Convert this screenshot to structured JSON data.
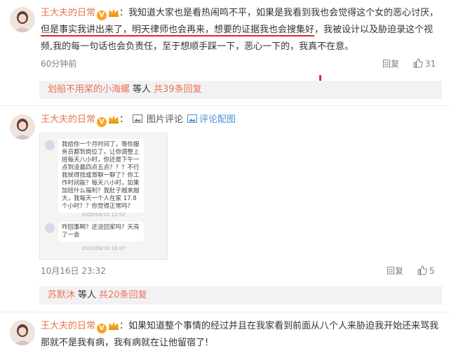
{
  "comments": [
    {
      "username": "王大夫的日常",
      "text_before": "：我知道大家也是看热闹鸣不平，如果是我看到我也会觉得这个女的恶心讨厌，",
      "text_underlined": "但是事实我讲出来了，明天律师也会再来，想要的证据我也会搜集好",
      "text_after": "，我被设计以及胁迫录这个视频,我的每一句话也会负责任，至于想顺手踩一下，恶心一下的，我真不在意。",
      "time": "60分钟前",
      "reply_label": "回复",
      "likes": "31",
      "replies": {
        "who": "划船不用桨的小海螺",
        "etc": "等人",
        "total": "共39条回复"
      }
    },
    {
      "username": "王大夫的日常",
      "text_before": "：",
      "pic_label": "图片评论",
      "pic_link": "评论配图",
      "time": "10月16日 23:32",
      "reply_label": "回复",
      "likes": "5",
      "replies": {
        "who": "苏默沐",
        "etc": "等人",
        "total": "共20条回复"
      },
      "chat_image": {
        "bubble1": "我给你一个月时间了，等你服务员都到岗位了，让你调整上班每天八小时，你还是下午一点到凌晨四点五点？？？不行我就得找或哥聊一聊了？你工作时间能？每天八小时，如果加班什么福利？我肚子越来越大，我每天一个人在家 17.8 个小时？？你觉得正常吗？",
        "time1": "2020/08/10 12:02",
        "bubble2": "咋回事啊？还没回家吗？天亮了一会",
        "time2": "2020/08/10 18:07"
      }
    },
    {
      "username": "王大夫的日常",
      "text": "：如果知道整个事情的经过并且在我家看到前面从八个人来胁迫我开始还来骂我那就不是我有病，我有病就在让他留宿了!"
    }
  ],
  "colors": {
    "accent": "#eb7350",
    "underline": "#e0262a",
    "link": "#4a8fd6",
    "reply_bg": "#f2f2f5"
  },
  "icons": {
    "like": "thumbs-up-icon",
    "vip": "vip-v-icon",
    "crown": "crown-icon",
    "picture": "picture-icon"
  }
}
